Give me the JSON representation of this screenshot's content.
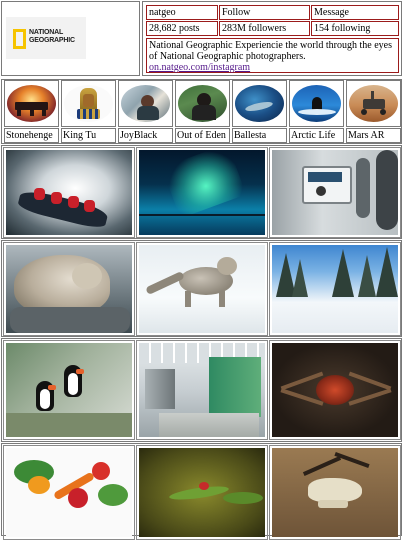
{
  "profile": {
    "logo_text": "NATIONAL\nGEOGRAPHIC",
    "username": "natgeo",
    "follow_label": "Follow",
    "message_label": "Message",
    "posts": "28,682 posts",
    "followers": "283M followers",
    "following": "154 following",
    "bio": "National Geographic Experiencie the world through the eyes of National Geographic photographers.",
    "link": "on.natgeo.com/instagram"
  },
  "stories": [
    {
      "label": "Stonehenge"
    },
    {
      "label": "King Tu"
    },
    {
      "label": "JoyBlack"
    },
    {
      "label": "Out of Eden"
    },
    {
      "label": "Ballesta"
    },
    {
      "label": "Arctic Life"
    },
    {
      "label": "Mars AR"
    }
  ],
  "colors": {
    "accent_border": "#9b1b1b",
    "logo_yellow": "#f6c400",
    "link": "#551a8b"
  }
}
